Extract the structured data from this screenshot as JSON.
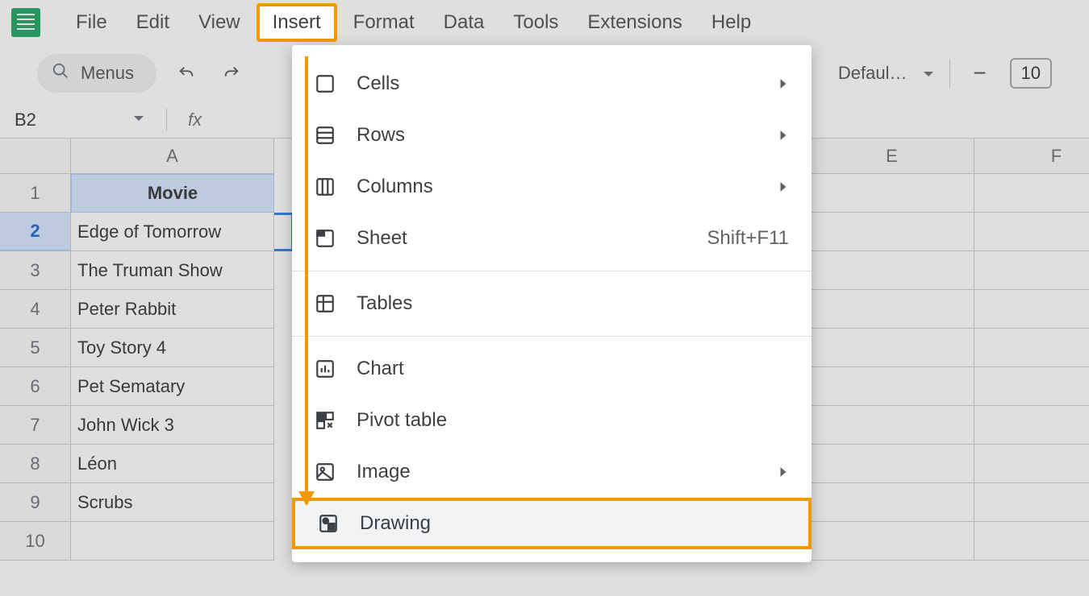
{
  "menubar": {
    "items": [
      "File",
      "Edit",
      "View",
      "Insert",
      "Format",
      "Data",
      "Tools",
      "Extensions",
      "Help"
    ],
    "active": "Insert"
  },
  "toolbar": {
    "search_label": "Menus",
    "default_label": "Defaul…",
    "font_size": "10",
    "minus": "−"
  },
  "namebox": {
    "ref": "B2"
  },
  "sheet": {
    "columns": [
      "A",
      "E",
      "F"
    ],
    "header_cell": "Movie",
    "rows": [
      {
        "n": "1",
        "a": "Movie"
      },
      {
        "n": "2",
        "a": "Edge of Tomorrow"
      },
      {
        "n": "3",
        "a": "The Truman Show"
      },
      {
        "n": "4",
        "a": "Peter Rabbit"
      },
      {
        "n": "5",
        "a": "Toy Story 4"
      },
      {
        "n": "6",
        "a": "Pet Sematary"
      },
      {
        "n": "7",
        "a": "John Wick 3"
      },
      {
        "n": "8",
        "a": "Léon"
      },
      {
        "n": "9",
        "a": "Scrubs"
      },
      {
        "n": "10",
        "a": ""
      }
    ]
  },
  "dropdown": {
    "items": [
      {
        "icon": "cells",
        "label": "Cells",
        "submenu": true
      },
      {
        "icon": "rows",
        "label": "Rows",
        "submenu": true
      },
      {
        "icon": "columns",
        "label": "Columns",
        "submenu": true
      },
      {
        "icon": "sheet",
        "label": "Sheet",
        "shortcut": "Shift+F11"
      },
      {
        "sep": true
      },
      {
        "icon": "tables",
        "label": "Tables"
      },
      {
        "sep": true
      },
      {
        "icon": "chart",
        "label": "Chart"
      },
      {
        "icon": "pivot",
        "label": "Pivot table"
      },
      {
        "icon": "image",
        "label": "Image",
        "submenu": true
      },
      {
        "icon": "drawing",
        "label": "Drawing",
        "highlighted": true
      }
    ]
  }
}
